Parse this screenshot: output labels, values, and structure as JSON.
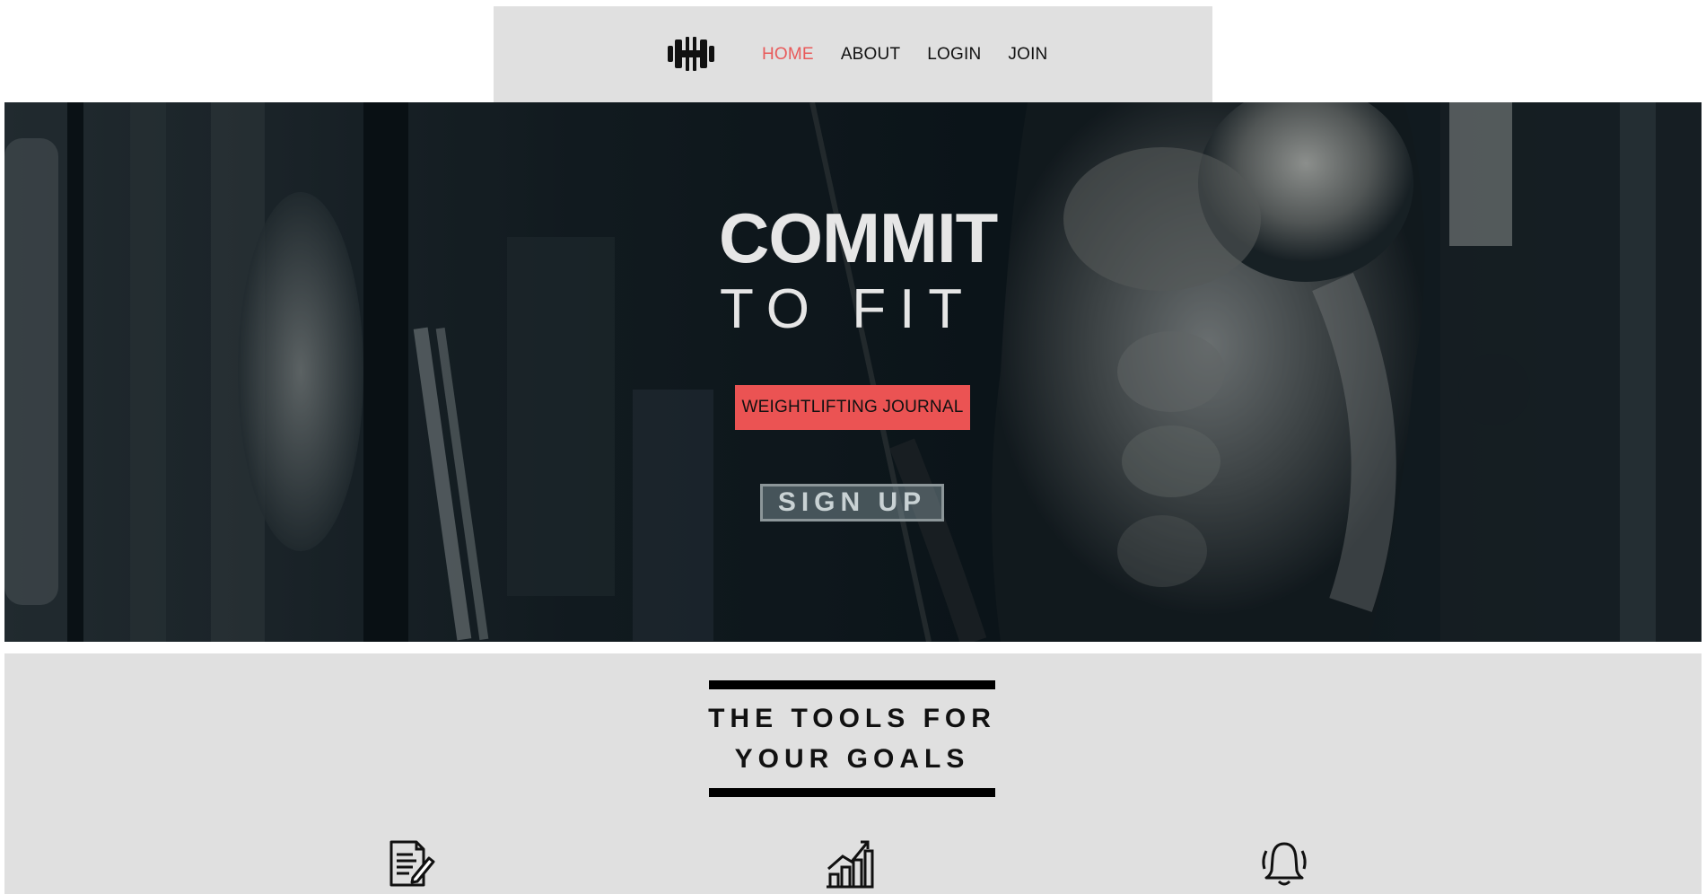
{
  "nav": {
    "logo_icon": "dumbbell-icon",
    "links": [
      {
        "label": "HOME",
        "active": true
      },
      {
        "label": "ABOUT",
        "active": false
      },
      {
        "label": "LOGIN",
        "active": false
      },
      {
        "label": "JOIN",
        "active": false
      }
    ]
  },
  "hero": {
    "title_line1": "COMMIT",
    "title_line2": "TO FIT",
    "journal_button": "WEIGHTLIFTING JOURNAL",
    "signup_button": "SIGN UP"
  },
  "tools": {
    "heading_line1": "THE TOOLS FOR",
    "heading_line2": "YOUR GOALS",
    "icons": [
      "journal-edit-icon",
      "growth-chart-icon",
      "notification-bell-icon"
    ]
  },
  "colors": {
    "accent": "#eb5353",
    "nav_background": "#e0e0e0",
    "section_background": "#e0e0e0",
    "hero_text": "#e6e6e6"
  }
}
